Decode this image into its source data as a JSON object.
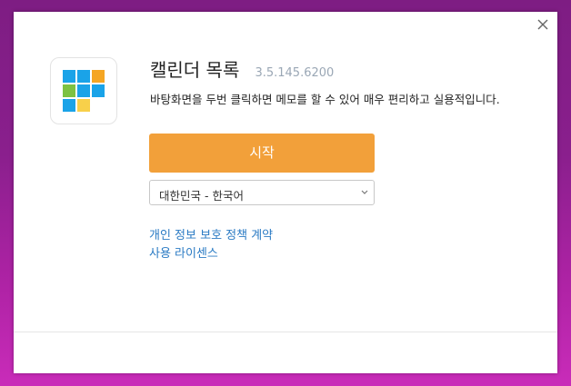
{
  "app": {
    "name": "캘린더 목록",
    "version": "3.5.145.6200",
    "description": "바탕화면을 두번 클릭하면 메모를 할 수 있어 매우 편리하고 실용적입니다.",
    "icon": "calendar-grid-icon"
  },
  "actions": {
    "start_label": "시작"
  },
  "language": {
    "selected": "대한민국 - 한국어"
  },
  "links": {
    "privacy": "개인 정보 보호 정책 계약",
    "license": "사용 라이센스"
  },
  "colors": {
    "accent": "#f2a03a",
    "link": "#2b7bc4",
    "version": "#9aa7b5",
    "tile_blue": "#1aa3e8",
    "tile_orange": "#f5a623",
    "tile_green": "#7dc242",
    "tile_yellow": "#f8d04a"
  }
}
